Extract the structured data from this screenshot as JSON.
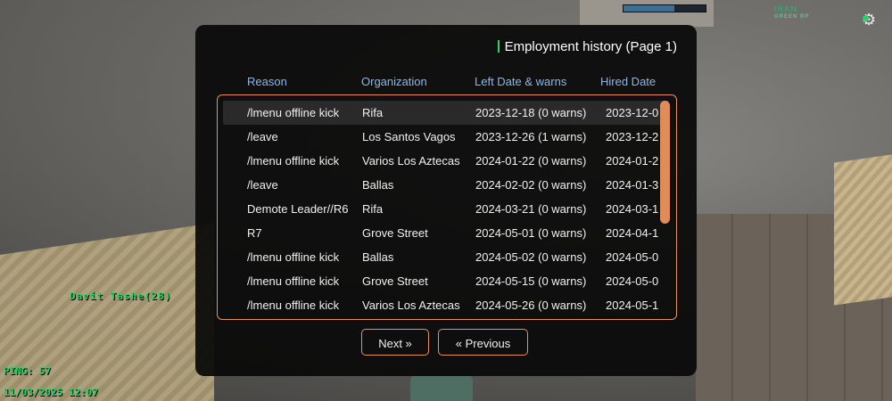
{
  "dialog": {
    "title": "Employment history (Page 1)",
    "accent_color": "#e8915a",
    "header_color": "#8fb6e8",
    "columns": [
      "Reason",
      "Organization",
      "Left Date & warns",
      "Hired Date"
    ],
    "rows": [
      [
        "/lmenu offline kick",
        "Rifa",
        "2023-12-18 (0 warns)",
        "2023-12-0"
      ],
      [
        "/leave",
        "Los Santos Vagos",
        "2023-12-26 (1 warns)",
        "2023-12-2"
      ],
      [
        "/lmenu offline kick",
        "Varios Los Aztecas",
        "2024-01-22 (0 warns)",
        "2024-01-2"
      ],
      [
        "/leave",
        "Ballas",
        "2024-02-02 (0 warns)",
        "2024-01-3"
      ],
      [
        "Demote Leader//R6",
        "Rifa",
        "2024-03-21 (0 warns)",
        "2024-03-1"
      ],
      [
        "R7",
        "Grove Street",
        "2024-05-01 (0 warns)",
        "2024-04-1"
      ],
      [
        "/lmenu offline kick",
        "Ballas",
        "2024-05-02 (0 warns)",
        "2024-05-0"
      ],
      [
        "/lmenu offline kick",
        "Grove Street",
        "2024-05-15 (0 warns)",
        "2024-05-0"
      ],
      [
        "/lmenu offline kick",
        "Varios Los Aztecas",
        "2024-05-26 (0 warns)",
        "2024-05-1"
      ]
    ],
    "selected_row": 0,
    "buttons": {
      "next": "Next »",
      "previous": "« Previous"
    }
  },
  "hud": {
    "server_logo": "IRAN",
    "server_logo_sub": "GREEN RP",
    "player_name": "Davit Tashe(28)",
    "ping": "PING: 57",
    "datetime": "11/03/2025 12:07"
  }
}
